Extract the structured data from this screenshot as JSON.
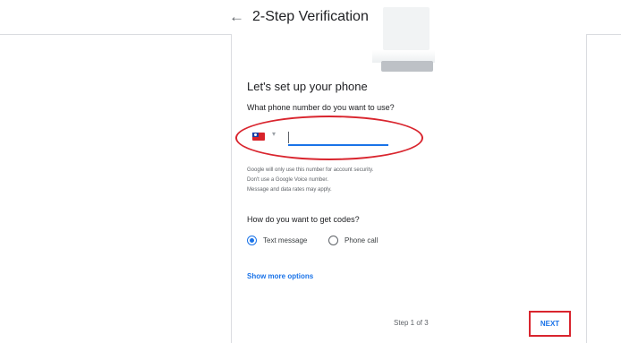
{
  "header": {
    "back_icon": "←",
    "title": "2-Step Verification"
  },
  "setup": {
    "heading": "Let's set up your phone",
    "question": "What phone number do you want to use?",
    "caret_icon": "▾",
    "phone_value": "",
    "help_lines": [
      "Google will only use this number for account security.",
      "Don't use a Google Voice number.",
      "Message and data rates may apply."
    ],
    "codes_question": "How do you want to get codes?",
    "options": [
      {
        "label": "Text message",
        "selected": true
      },
      {
        "label": "Phone call",
        "selected": false
      }
    ],
    "more_options": "Show more options"
  },
  "footer": {
    "step_text": "Step 1 of 3",
    "next_label": "NEXT"
  },
  "colors": {
    "accent": "#1a73e8",
    "highlight": "#d9252e"
  }
}
